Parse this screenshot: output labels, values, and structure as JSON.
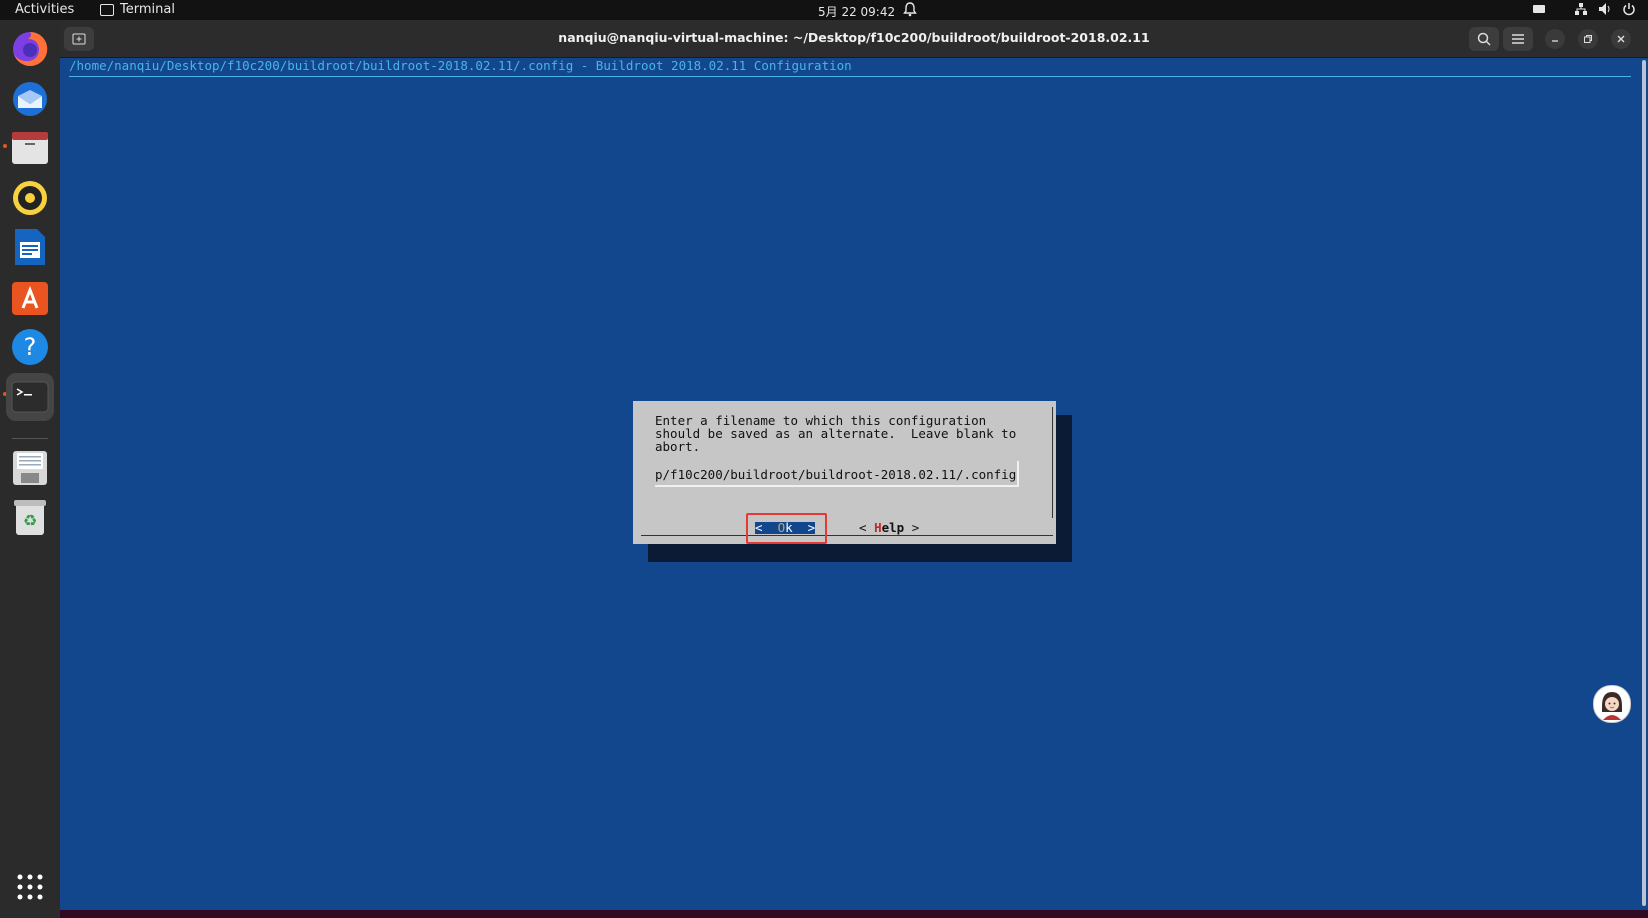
{
  "topbar": {
    "activities": "Activities",
    "app_name": "Terminal",
    "clock": "5月 22  09:42"
  },
  "dock": {
    "items": [
      "firefox",
      "thunderbird",
      "files",
      "rhythmbox",
      "libreoffice-writer",
      "app-center",
      "help",
      "terminal",
      "save-disk",
      "trash"
    ]
  },
  "window": {
    "title": "nanqiu@nanqiu-virtual-machine: ~/Desktop/f10c200/buildroot/buildroot-2018.02.11"
  },
  "terminal": {
    "config_header": "/home/nanqiu/Desktop/f10c200/buildroot/buildroot-2018.02.11/.config - Buildroot 2018.02.11 Configuration",
    "dialog": {
      "prompt": "Enter a filename to which this configuration\nshould be saved as an alternate.  Leave blank to\nabort.",
      "input_value": "p/f10c200/buildroot/buildroot-2018.02.11/.config",
      "ok_open": "<  ",
      "ok_hot": "O",
      "ok_close": "k  >",
      "help_open": "< ",
      "help_hot": "H",
      "help_rest": "elp",
      "help_close": " >"
    }
  },
  "colors": {
    "terminal_bg": "#12478e",
    "dialog_bg": "#c6c6c6",
    "highlight_frame": "#e53935",
    "accent": "#e95420"
  }
}
